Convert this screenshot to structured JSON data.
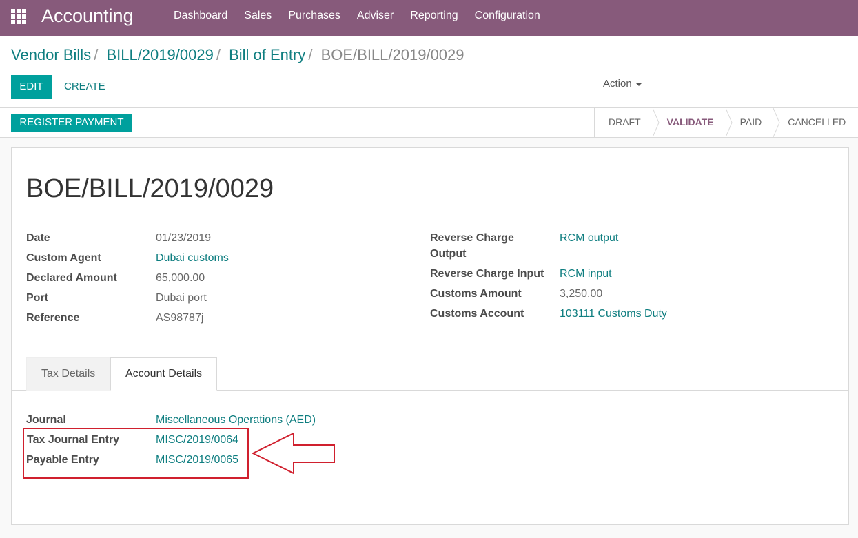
{
  "navbar": {
    "app_title": "Accounting",
    "menu": [
      "Dashboard",
      "Sales",
      "Purchases",
      "Adviser",
      "Reporting",
      "Configuration"
    ]
  },
  "breadcrumb": {
    "items": [
      "Vendor Bills",
      "BILL/2019/0029",
      "Bill of Entry"
    ],
    "separator": "/",
    "active": "BOE/BILL/2019/0029"
  },
  "toolbar": {
    "edit_label": "EDIT",
    "create_label": "CREATE",
    "action_label": "Action"
  },
  "statusbar": {
    "register_payment_label": "REGISTER PAYMENT",
    "stages": [
      "DRAFT",
      "VALIDATE",
      "PAID",
      "CANCELLED"
    ],
    "active_stage": "VALIDATE"
  },
  "form": {
    "title": "BOE/BILL/2019/0029",
    "left_fields": {
      "date": {
        "label": "Date",
        "value": "01/23/2019"
      },
      "custom_agent": {
        "label": "Custom Agent",
        "value": "Dubai customs"
      },
      "declared_amount": {
        "label": "Declared Amount",
        "value": "65,000.00"
      },
      "port": {
        "label": "Port",
        "value": "Dubai port"
      },
      "reference": {
        "label": "Reference",
        "value": "AS98787j"
      }
    },
    "right_fields": {
      "reverse_charge_output": {
        "label_line1": "Reverse Charge",
        "label_line2": "Output",
        "value": "RCM output"
      },
      "reverse_charge_input": {
        "label": "Reverse Charge Input",
        "value": "RCM input"
      },
      "customs_amount": {
        "label": "Customs Amount",
        "value": "3,250.00"
      },
      "customs_account": {
        "label": "Customs Account",
        "value": "103111 Customs Duty"
      }
    },
    "tabs": [
      "Tax Details",
      "Account Details"
    ],
    "active_tab": "Account Details",
    "account_details": {
      "journal": {
        "label": "Journal",
        "value": "Miscellaneous Operations (AED)"
      },
      "tax_journal_entry": {
        "label": "Tax Journal Entry",
        "value": "MISC/2019/0064"
      },
      "payable_entry": {
        "label": "Payable Entry",
        "value": "MISC/2019/0065"
      }
    }
  },
  "colors": {
    "navbar": "#875a7b",
    "primary_button": "#00a09d",
    "link": "#0f7e80",
    "annotation": "#d0202e"
  }
}
